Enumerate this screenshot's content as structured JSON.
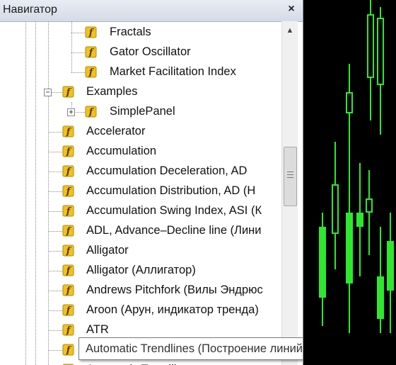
{
  "navigator": {
    "title": "Навигатор",
    "close_icon": "×",
    "items": [
      {
        "label": "Fractals",
        "level": 2
      },
      {
        "label": "Gator Oscillator",
        "level": 2
      },
      {
        "label": "Market Facilitation Index",
        "level": 2
      },
      {
        "label": "Examples",
        "level": 1,
        "expander": "−"
      },
      {
        "label": "SimplePanel",
        "level": 2,
        "expander": "+"
      },
      {
        "label": "Accelerator",
        "level": 1
      },
      {
        "label": "Accumulation",
        "level": 1
      },
      {
        "label": "Accumulation Deceleration, AD",
        "level": 1
      },
      {
        "label": "Accumulation Distribution, AD (Н",
        "level": 1
      },
      {
        "label": "Accumulation Swing Index, ASI (К",
        "level": 1
      },
      {
        "label": "ADL, Advance–Decline line (Лини",
        "level": 1
      },
      {
        "label": "Alligator",
        "level": 1
      },
      {
        "label": "Alligator (Аллигатор)",
        "level": 1
      },
      {
        "label": "Andrews Pitchfork (Вилы Эндрюс",
        "level": 1
      },
      {
        "label": "Aroon (Арун, индикатор тренда)",
        "level": 1
      },
      {
        "label": "ATR",
        "level": 1
      },
      {
        "label": "Automatic Trendlines",
        "level": 1
      },
      {
        "label": "Automatic Trendlines",
        "level": 1
      }
    ]
  },
  "tooltip": {
    "text": "Automatic Trendlines (Построение линий тренда)"
  },
  "scrollbar": {
    "up_arrow": "▲",
    "down_arrow": "▼"
  },
  "icons": {
    "indicator": "indicator-f-icon",
    "color": "#f2c21a"
  },
  "chart": {
    "up_color": "#2ee82e",
    "background": "#000000"
  }
}
